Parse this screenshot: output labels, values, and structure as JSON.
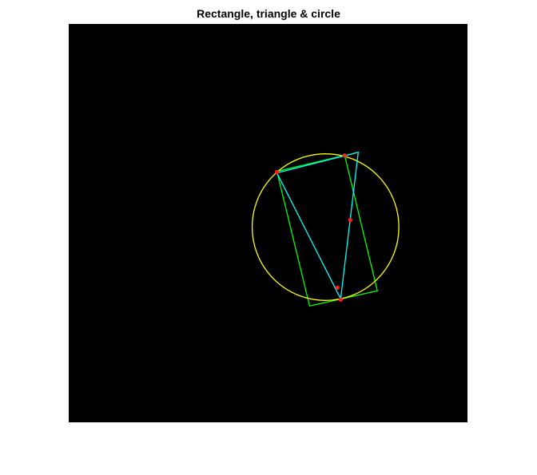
{
  "title": "Rectangle, triangle & circle",
  "colors": {
    "background": "#000000",
    "rectangle": "#00ff00",
    "triangle": "#00ffff",
    "circle": "#ffff00",
    "points": "#ff2020"
  },
  "chart_data": {
    "type": "scatter",
    "title": "Rectangle, triangle & circle",
    "xlim": [
      0,
      500
    ],
    "ylim": [
      0,
      500
    ],
    "grid": false,
    "rectangle": {
      "vertices": [
        [
          302,
          354
        ],
        [
          387,
          335
        ],
        [
          346,
          165
        ],
        [
          261,
          185
        ]
      ]
    },
    "triangle": {
      "vertices": [
        [
          341,
          345
        ],
        [
          363,
          161
        ],
        [
          261,
          187
        ]
      ]
    },
    "circle": {
      "center": [
        322,
        255
      ],
      "radius": 92
    },
    "points": [
      [
        341,
        346
      ],
      [
        337,
        331
      ],
      [
        353,
        246
      ],
      [
        261,
        186
      ],
      [
        346,
        165
      ]
    ]
  }
}
